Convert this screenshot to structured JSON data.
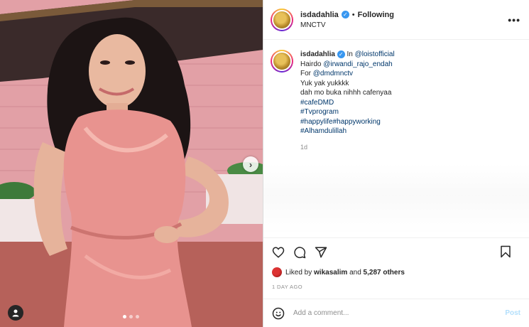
{
  "post": {
    "username": "isdadahlia",
    "follow_sep": "•",
    "follow_label": "Following",
    "location": "MNCTV",
    "more_label": "•••"
  },
  "caption": {
    "username": "isdadahlia",
    "lines": [
      {
        "prefix": "In ",
        "link": "@loistofficial"
      },
      {
        "prefix": "Hairdo ",
        "link": "@irwandi_rajo_endah"
      },
      {
        "prefix": "For ",
        "link": "@dmdmnctv"
      },
      {
        "text": "Yuk yak yukkkk"
      },
      {
        "text": "dah mo buka nihhh cafenyaa"
      },
      {
        "link": "#cafeDMD"
      },
      {
        "link": "#Tvprogram"
      },
      {
        "link": "#happylife#happyworking"
      },
      {
        "link": "#Alhamdulillah"
      }
    ],
    "time": "1d"
  },
  "likes": {
    "prefix": "Liked by ",
    "user": "wikasalim",
    "mid": " and ",
    "count": "5,287 others"
  },
  "posted_ago": "1 DAY AGO",
  "comment": {
    "placeholder": "Add a comment...",
    "post_label": "Post"
  },
  "photo": {
    "next_label": "›",
    "carousel_count": 3,
    "carousel_active": 0
  },
  "colors": {
    "link": "#00376b",
    "verified": "#3897f0",
    "post_disabled": "#b2dffc"
  },
  "icons": [
    "heart-icon",
    "comment-icon",
    "share-icon",
    "bookmark-icon",
    "emoji-icon",
    "user-tag-icon",
    "chevron-right-icon",
    "verified-icon"
  ]
}
